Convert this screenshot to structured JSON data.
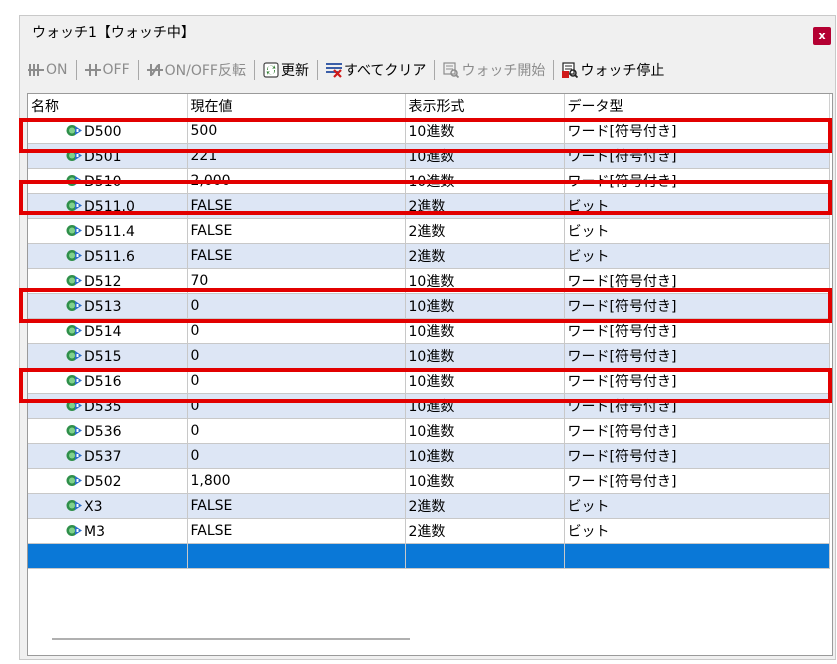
{
  "window": {
    "title": "ウォッチ1【ウォッチ中】",
    "close_label": "x"
  },
  "toolbar": {
    "on": "ON",
    "off": "OFF",
    "toggle": "ON/OFF反転",
    "refresh": "更新",
    "clear_all": "すべてクリア",
    "start_watch": "ウォッチ開始",
    "stop_watch": "ウォッチ停止"
  },
  "columns": [
    "名称",
    "現在値",
    "表示形式",
    "データ型"
  ],
  "rows": [
    [
      "D500",
      "500",
      "10進数",
      "ワード[符号付き]"
    ],
    [
      "D501",
      "221",
      "10進数",
      "ワード[符号付き]"
    ],
    [
      "D510",
      "2,000",
      "10進数",
      "ワード[符号付き]"
    ],
    [
      "D511.0",
      "FALSE",
      "2進数",
      "ビット"
    ],
    [
      "D511.4",
      "FALSE",
      "2進数",
      "ビット"
    ],
    [
      "D511.6",
      "FALSE",
      "2進数",
      "ビット"
    ],
    [
      "D512",
      "70",
      "10進数",
      "ワード[符号付き]"
    ],
    [
      "D513",
      "0",
      "10進数",
      "ワード[符号付き]"
    ],
    [
      "D514",
      "0",
      "10進数",
      "ワード[符号付き]"
    ],
    [
      "D515",
      "0",
      "10進数",
      "ワード[符号付き]"
    ],
    [
      "D516",
      "0",
      "10進数",
      "ワード[符号付き]"
    ],
    [
      "D535",
      "0",
      "10進数",
      "ワード[符号付き]"
    ],
    [
      "D536",
      "0",
      "10進数",
      "ワード[符号付き]"
    ],
    [
      "D537",
      "0",
      "10進数",
      "ワード[符号付き]"
    ],
    [
      "D502",
      "1,800",
      "10進数",
      "ワード[符号付き]"
    ],
    [
      "X3",
      "FALSE",
      "2進数",
      "ビット"
    ],
    [
      "M3",
      "FALSE",
      "2進数",
      "ビット"
    ]
  ],
  "colors": {
    "highlight": "#e20000",
    "selection": "#0a78d7",
    "alt_row": "#dde6f5",
    "close_button": "#b40032"
  }
}
